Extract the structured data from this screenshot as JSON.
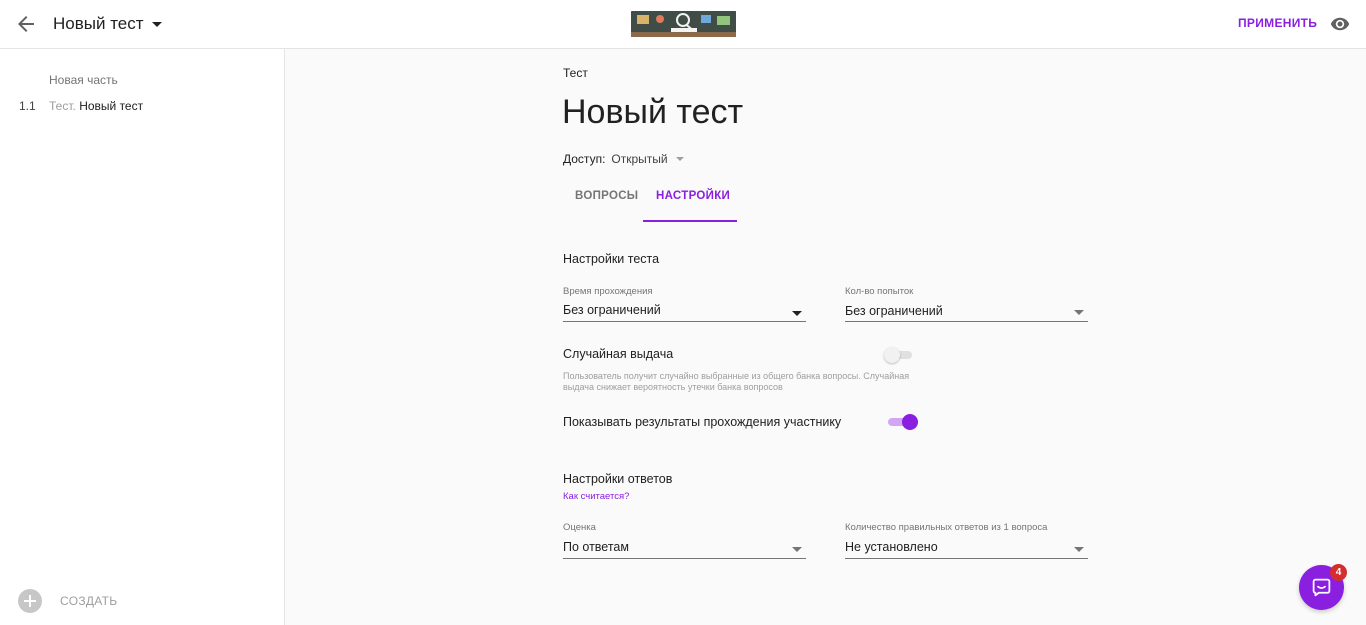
{
  "header": {
    "title": "Новый тест",
    "apply_label": "ПРИМЕНИТЬ"
  },
  "sidebar": {
    "section_label": "Новая часть",
    "items": [
      {
        "number": "1.1",
        "prefix": "Тест.",
        "label": "Новый тест"
      }
    ],
    "create_label": "СОЗДАТЬ"
  },
  "main": {
    "breadcrumb": "Тест",
    "title": "Новый тест",
    "access": {
      "label": "Доступ:",
      "value": "Открытый"
    },
    "tabs": [
      {
        "label": "ВОПРОСЫ",
        "active": false
      },
      {
        "label": "НАСТРОЙКИ",
        "active": true
      }
    ],
    "test_settings": {
      "heading": "Настройки теста",
      "time": {
        "label": "Время прохождения",
        "value": "Без ограничений"
      },
      "attempts": {
        "label": "Кол-во попыток",
        "value": "Без ограничений"
      },
      "random": {
        "title": "Случайная выдача",
        "description": "Пользователь получит случайно выбранные из общего банка вопросы. Случайная выдача снижает вероятность утечки банка вопросов",
        "enabled": false
      },
      "show_results": {
        "title": "Показывать результаты прохождения участнику",
        "enabled": true
      }
    },
    "answer_settings": {
      "heading": "Настройки ответов",
      "how_link": "Как считается?",
      "grade": {
        "label": "Оценка",
        "value": "По ответам"
      },
      "correct_count": {
        "label": "Количество правильных ответов из 1 вопроса",
        "value": "Не установлено"
      }
    }
  },
  "chat": {
    "badge_count": "4"
  },
  "colors": {
    "accent": "#8a1fe0",
    "badge": "#d32f2f"
  }
}
